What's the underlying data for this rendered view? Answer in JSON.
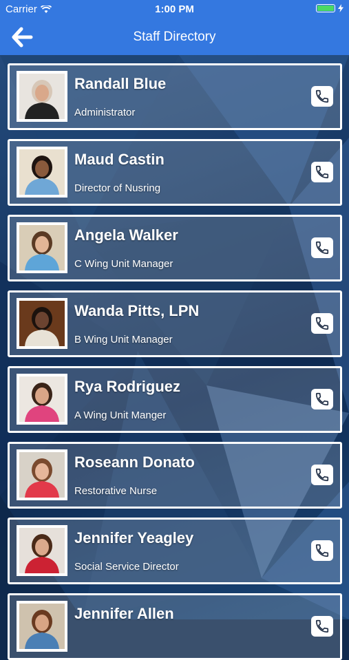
{
  "status_bar": {
    "carrier": "Carrier",
    "time": "1:00 PM",
    "wifi_icon": "wifi-icon",
    "battery_icon": "battery-icon",
    "charging_icon": "bolt-icon"
  },
  "nav": {
    "title": "Staff Directory",
    "back_icon": "arrow-left-icon"
  },
  "staff": [
    {
      "name": "Randall Blue",
      "title": "Administrator",
      "shirt": "#222222",
      "skin": "#d9a88a",
      "hair": "#d7c7b7",
      "bg": "#e8e4df"
    },
    {
      "name": "Maud Castin",
      "title": "Director of Nusring",
      "shirt": "#6fa7d6",
      "skin": "#8a5a3c",
      "hair": "#1e1410",
      "bg": "#e9e0cf"
    },
    {
      "name": "Angela Walker",
      "title": "C Wing Unit Manager",
      "shirt": "#5ea5d8",
      "skin": "#e2b596",
      "hair": "#5a3a24",
      "bg": "#d9cdb7"
    },
    {
      "name": "Wanda Pitts, LPN",
      "title": "B Wing Unit Manager",
      "shirt": "#e8e2d6",
      "skin": "#6b4330",
      "hair": "#1b120d",
      "bg": "#6a3a1c"
    },
    {
      "name": "Rya Rodriguez",
      "title": "A Wing Unit Manger",
      "shirt": "#e0447e",
      "skin": "#d9a587",
      "hair": "#3a2418",
      "bg": "#ece7e1"
    },
    {
      "name": "Roseann Donato",
      "title": "Restorative Nurse",
      "shirt": "#e23a4a",
      "skin": "#e6b69a",
      "hair": "#7a4a2e",
      "bg": "#d8d2c8"
    },
    {
      "name": "Jennifer Yeagley",
      "title": "Social Service Director",
      "shirt": "#cc2233",
      "skin": "#dba98c",
      "hair": "#4a2a18",
      "bg": "#e6e0da"
    },
    {
      "name": "Jennifer  Allen",
      "title": "",
      "shirt": "#4a7fb5",
      "skin": "#d8a484",
      "hair": "#6a3a20",
      "bg": "#cfc2ae"
    }
  ],
  "phone_icon": "phone-icon",
  "colors": {
    "nav_bar": "#3478e0",
    "card_border": "#ffffff",
    "battery": "#4cd964"
  }
}
